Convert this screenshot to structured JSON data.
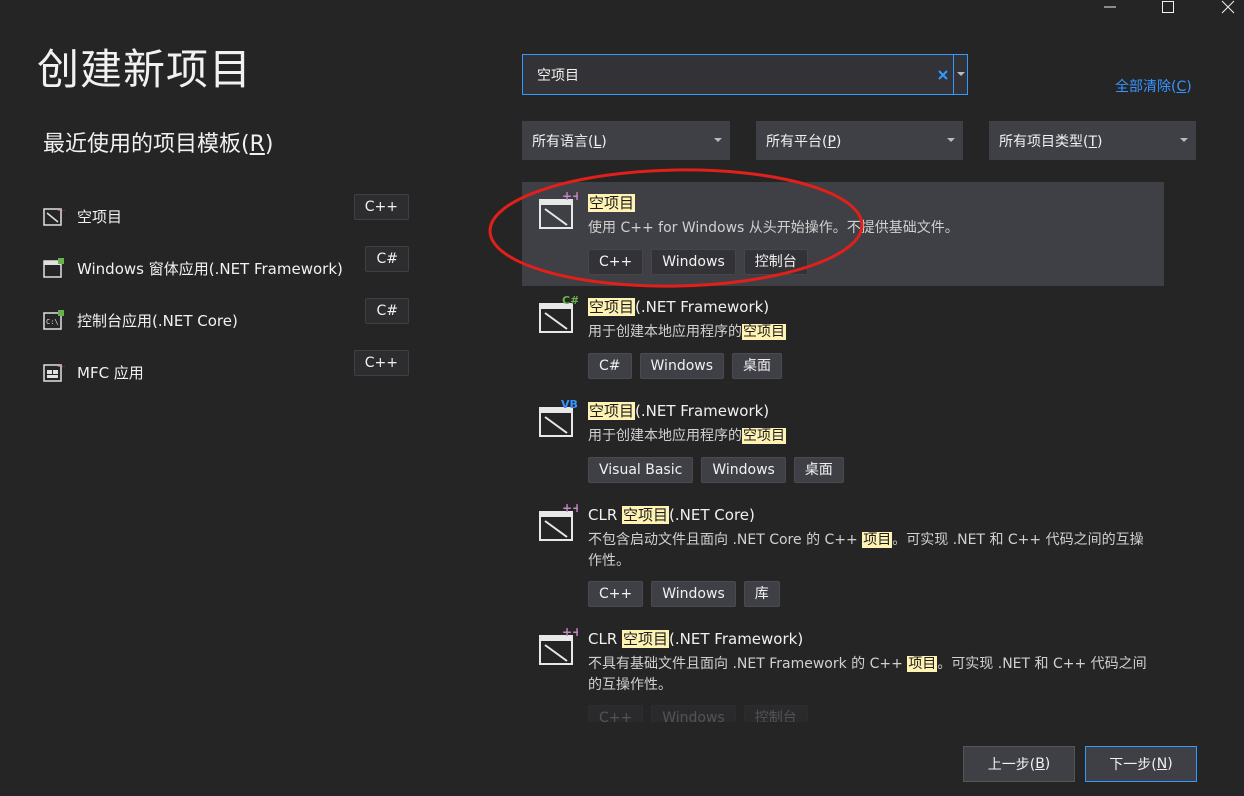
{
  "window": {
    "title": "创建新项目",
    "controls": [
      "minimize-icon",
      "maximize-icon",
      "close-icon"
    ]
  },
  "recent": {
    "title_prefix": "最近使用的项目模板(",
    "title_key": "R",
    "title_suffix": ")",
    "items": [
      {
        "label": "空项目",
        "badge": "C++",
        "icon": "empty-project-cpp-icon"
      },
      {
        "label": "Windows 窗体应用(.NET Framework)",
        "badge": "C#",
        "icon": "windows-forms-icon"
      },
      {
        "label": "控制台应用(.NET Core)",
        "badge": "C#",
        "icon": "console-app-icon"
      },
      {
        "label": "MFC 应用",
        "badge": "C++",
        "icon": "mfc-app-icon"
      }
    ]
  },
  "search": {
    "value": "空项目",
    "clear_all_prefix": "全部清除(",
    "clear_all_key": "C",
    "clear_all_suffix": ")"
  },
  "filters": [
    {
      "prefix": "所有语言(",
      "key": "L",
      "suffix": ")"
    },
    {
      "prefix": "所有平台(",
      "key": "P",
      "suffix": ")"
    },
    {
      "prefix": "所有项目类型(",
      "key": "T",
      "suffix": ")"
    }
  ],
  "results": [
    {
      "name_pre": "",
      "name_hl": "空项目",
      "name_post": "",
      "desc_pre": "使用 C++ for Windows 从头开始操作。不提供基础文件。",
      "desc_hl": "",
      "desc_post": "",
      "tags": [
        "C++",
        "Windows",
        "控制台"
      ],
      "lang_mark": "++",
      "lang_color": "#c586c0"
    },
    {
      "name_pre": "",
      "name_hl": "空项目",
      "name_post": "(.NET Framework)",
      "desc_pre": "用于创建本地应用程序的",
      "desc_hl": "空项目",
      "desc_post": "",
      "tags": [
        "C#",
        "Windows",
        "桌面"
      ],
      "lang_mark": "C#",
      "lang_color": "#6ab04c"
    },
    {
      "name_pre": "",
      "name_hl": "空项目",
      "name_post": "(.NET Framework)",
      "desc_pre": "用于创建本地应用程序的",
      "desc_hl": "空项目",
      "desc_post": "",
      "tags": [
        "Visual Basic",
        "Windows",
        "桌面"
      ],
      "lang_mark": "VB",
      "lang_color": "#3794ff"
    },
    {
      "name_pre": "CLR ",
      "name_hl": "空项目",
      "name_post": "(.NET Core)",
      "desc_pre": "不包含启动文件且面向 .NET Core 的 C++ ",
      "desc_hl": "项目",
      "desc_post": "。可实现 .NET 和 C++ 代码之间的互操作性。",
      "tags": [
        "C++",
        "Windows",
        "库"
      ],
      "lang_mark": "++",
      "lang_color": "#c586c0"
    },
    {
      "name_pre": "CLR ",
      "name_hl": "空项目",
      "name_post": "(.NET Framework)",
      "desc_pre": "不具有基础文件且面向 .NET Framework 的 C++ ",
      "desc_hl": "项目",
      "desc_post": "。可实现 .NET 和 C++ 代码之间的互操作性。",
      "tags": [
        "C++",
        "Windows",
        "控制台"
      ],
      "lang_mark": "++",
      "lang_color": "#c586c0"
    }
  ],
  "buttons": {
    "back_prefix": "上一步(",
    "back_key": "B",
    "back_suffix": ")",
    "next_prefix": "下一步(",
    "next_key": "N",
    "next_suffix": ")"
  },
  "colors": {
    "background": "#252526",
    "selected_row": "#3f3f46",
    "accent": "#3399ff",
    "highlight": "#fff3b3",
    "annotation": "#e0201a"
  }
}
